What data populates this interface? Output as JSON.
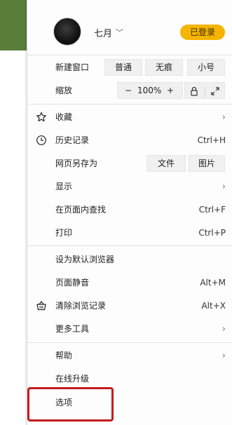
{
  "profile": {
    "username": "七月",
    "login_label": "已登录"
  },
  "menu": {
    "new_window": {
      "label": "新建窗口",
      "options": [
        "普通",
        "无痕",
        "小号"
      ]
    },
    "zoom": {
      "label": "缩放",
      "minus": "−",
      "value": "100%",
      "plus": "+"
    },
    "favorites": {
      "label": "收藏"
    },
    "history": {
      "label": "历史记录",
      "shortcut": "Ctrl+H"
    },
    "save_as": {
      "label": "网页另存为",
      "options": [
        "文件",
        "图片"
      ]
    },
    "display": {
      "label": "显示"
    },
    "find": {
      "label": "在页面内查找",
      "shortcut": "Ctrl+F"
    },
    "print": {
      "label": "打印",
      "shortcut": "Ctrl+P"
    },
    "default_browser": {
      "label": "设为默认浏览器"
    },
    "mute": {
      "label": "页面静音",
      "shortcut": "Alt+M"
    },
    "clear_data": {
      "label": "清除浏览记录",
      "shortcut": "Alt+X"
    },
    "more_tools": {
      "label": "更多工具"
    },
    "help": {
      "label": "帮助"
    },
    "upgrade": {
      "label": "在线升级"
    },
    "options": {
      "label": "选项"
    }
  },
  "icons": {
    "favorites": "star-icon",
    "history": "clock-icon",
    "clear_data": "basket-icon",
    "lock": "lock-icon",
    "fullscreen": "expand-icon",
    "chevron": "chevron-right-icon"
  },
  "colors": {
    "accent": "#f5b400",
    "highlight": "#c21d1d",
    "background_green": "#5b7d3a"
  }
}
